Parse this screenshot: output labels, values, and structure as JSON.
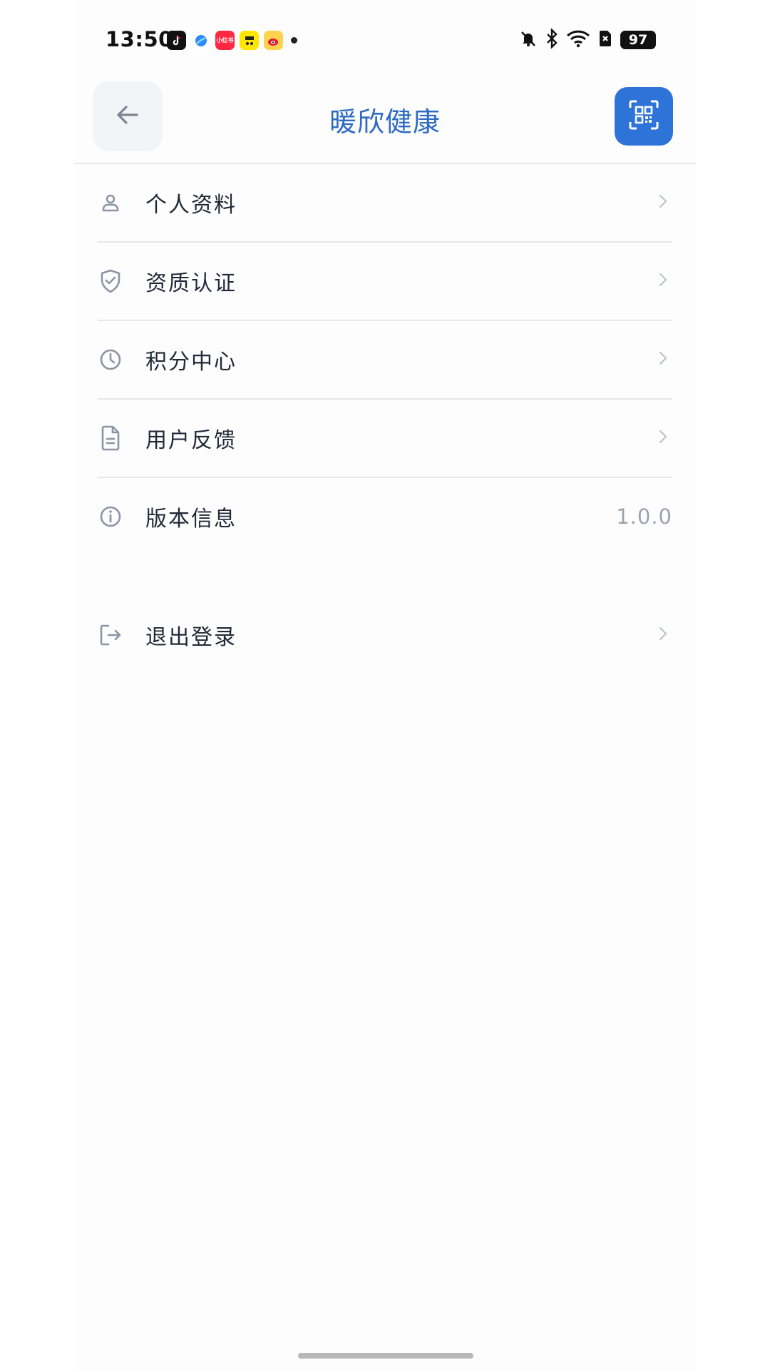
{
  "status_bar": {
    "time": "13:50",
    "battery": "97",
    "notification_apps": [
      "tiktok-icon",
      "browser-icon",
      "xiaohongshu-icon",
      "app-yellow-icon",
      "weibo-icon"
    ],
    "xiaohongshu_text": "小红书"
  },
  "header": {
    "title": "暖欣健康",
    "back_icon": "arrow-left-icon",
    "scan_icon": "qr-scan-icon"
  },
  "menu": {
    "items": [
      {
        "label": "个人资料",
        "icon": "user-icon"
      },
      {
        "label": "资质认证",
        "icon": "shield-check-icon"
      },
      {
        "label": "积分中心",
        "icon": "clock-icon"
      },
      {
        "label": "用户反馈",
        "icon": "document-icon"
      },
      {
        "label": "版本信息",
        "icon": "info-icon",
        "value": "1.0.0"
      }
    ],
    "logout": {
      "label": "退出登录",
      "icon": "logout-icon"
    }
  },
  "colors": {
    "accent": "#2e73d8",
    "title": "#2f6bc2",
    "text": "#1f2937",
    "muted": "#9aa3af",
    "divider": "#e6e8eb"
  }
}
